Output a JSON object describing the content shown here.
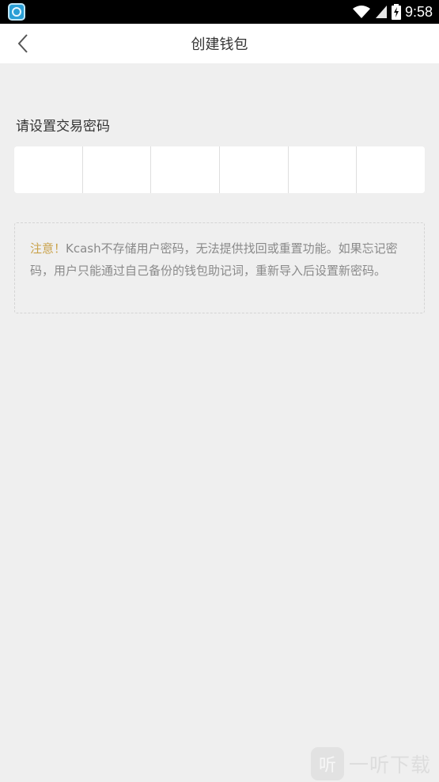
{
  "status_bar": {
    "time": "9:58",
    "icons": [
      "app-icon",
      "wifi-icon",
      "signal-icon",
      "battery-charging-icon"
    ]
  },
  "header": {
    "title": "创建钱包",
    "back_icon": "chevron-left-icon"
  },
  "form": {
    "label": "请设置交易密码",
    "pin_cells": [
      "",
      "",
      "",
      "",
      "",
      ""
    ]
  },
  "notice": {
    "label": "注意！",
    "text": "Kcash不存储用户密码，无法提供找回或重置功能。如果忘记密码，用户只能通过自己备份的钱包助记词，重新导入后设置新密码。"
  },
  "watermark": {
    "logo_text": "听",
    "text": "一听下载"
  },
  "colors": {
    "background": "#efefef",
    "notice_accent": "#c9a24a",
    "notice_text": "#8a8a8a"
  }
}
